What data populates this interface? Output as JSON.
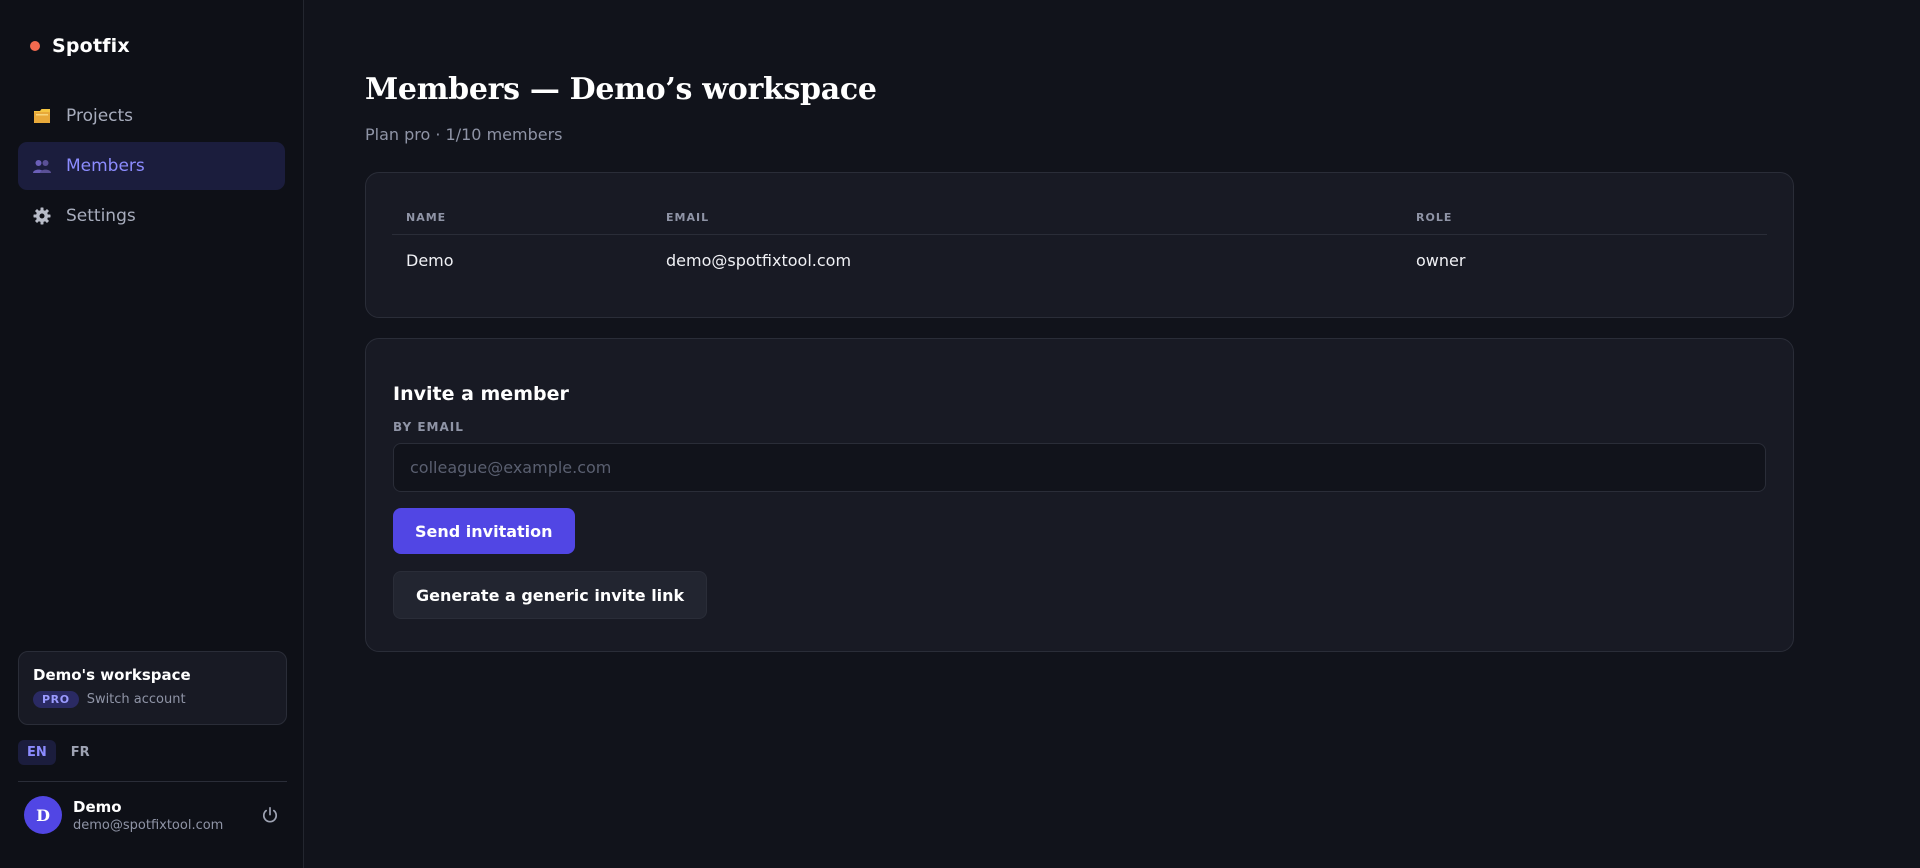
{
  "brand": {
    "name": "Spotfix",
    "dot_color": "#f26a4f"
  },
  "nav": {
    "items": [
      {
        "label": "Projects",
        "icon": "folder-icon",
        "active": false
      },
      {
        "label": "Members",
        "icon": "people-icon",
        "active": true
      },
      {
        "label": "Settings",
        "icon": "gear-icon",
        "active": false
      }
    ]
  },
  "workspace": {
    "name": "Demo's workspace",
    "plan_badge": "PRO",
    "switch_label": "Switch account"
  },
  "languages": {
    "en": "EN",
    "fr": "FR",
    "active": "EN"
  },
  "user": {
    "initial": "D",
    "name": "Demo",
    "email": "demo@spotfixtool.com",
    "power_icon": "power-icon"
  },
  "page": {
    "title": "Members — Demo’s workspace",
    "subtitle": "Plan pro · 1/10 members"
  },
  "members_table": {
    "headers": {
      "name": "NAME",
      "email": "EMAIL",
      "role": "ROLE"
    },
    "rows": [
      {
        "name": "Demo",
        "email": "demo@spotfixtool.com",
        "role": "owner"
      }
    ]
  },
  "invite": {
    "title": "Invite a member",
    "field_label": "BY EMAIL",
    "placeholder": "colleague@example.com",
    "value": "",
    "send_label": "Send invitation",
    "generic_link_label": "Generate a generic invite link"
  },
  "colors": {
    "accent": "#5146e4",
    "accent_text": "#8c8cff",
    "background": "#11131b",
    "card": "#181a24"
  }
}
